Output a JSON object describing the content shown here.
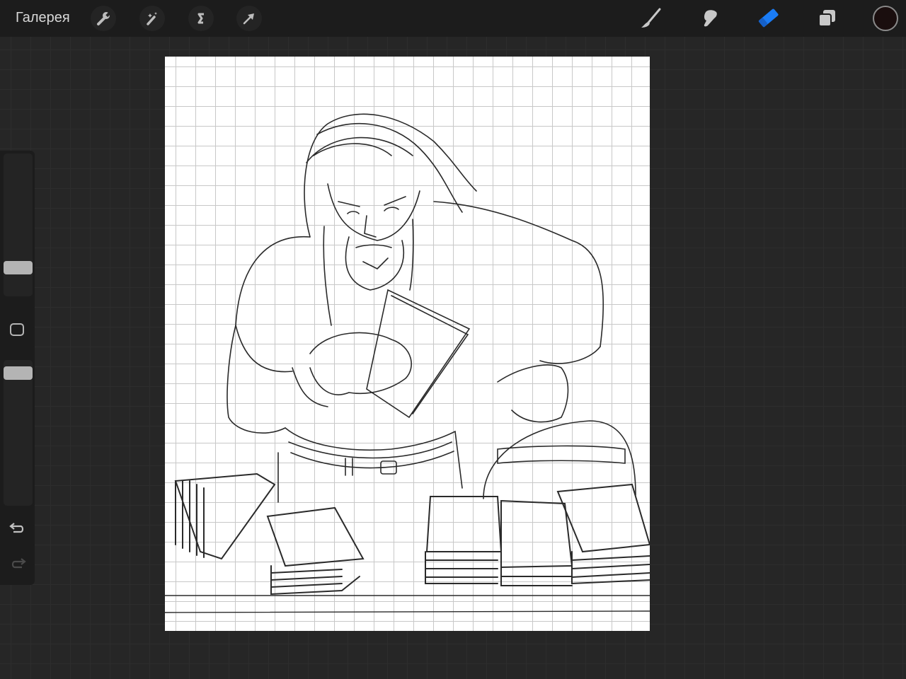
{
  "topbar": {
    "gallery_label": "Галерея",
    "left_tools": [
      "wrench-icon",
      "magic-wand-icon",
      "selection-icon",
      "transform-arrow-icon"
    ],
    "right_tools": [
      "brush-icon",
      "smudge-icon",
      "eraser-icon",
      "layers-icon"
    ],
    "active_tool": "eraser",
    "accent_color": "#1a7cf5",
    "current_color": "#1a0e0e"
  },
  "sidebar": {
    "brush_size": 0.17,
    "opacity": 0.95
  }
}
